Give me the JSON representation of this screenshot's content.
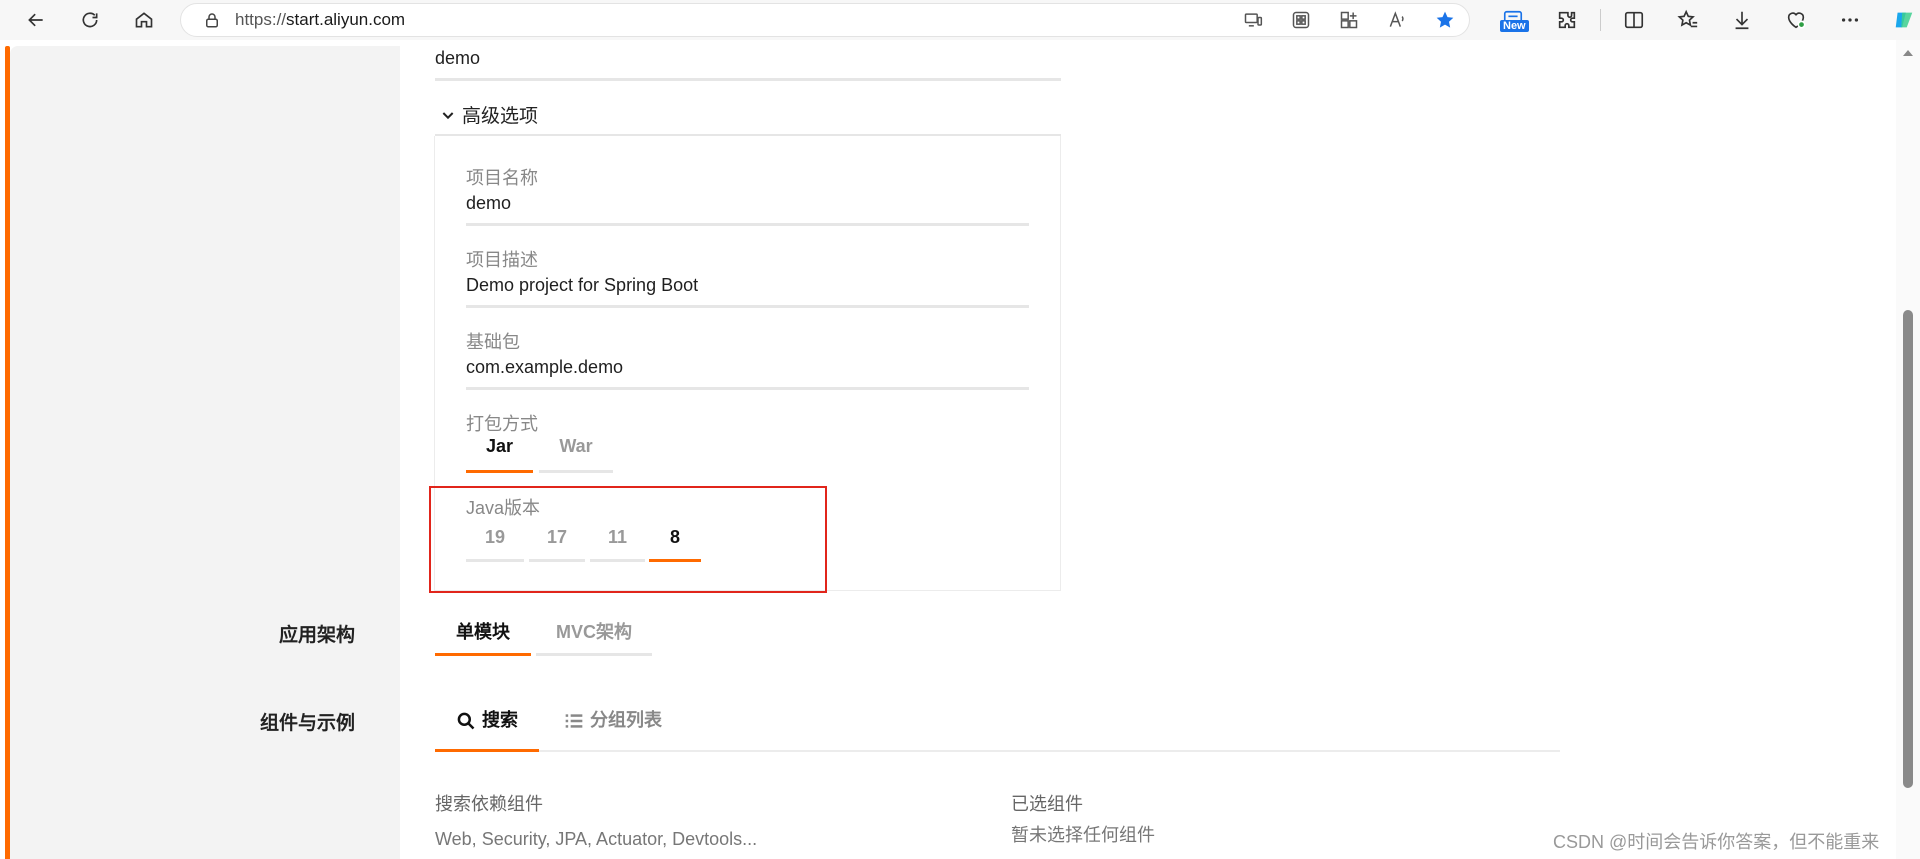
{
  "browser": {
    "url_scheme": "https://",
    "url_host": "start.aliyun.com",
    "new_badge": "New"
  },
  "form": {
    "artifact_value": "demo",
    "advanced_options_label": "高级选项",
    "project_name_label": "项目名称",
    "project_name_value": "demo",
    "description_label": "项目描述",
    "description_value": "Demo project for Spring Boot",
    "base_package_label": "基础包",
    "base_package_value": "com.example.demo",
    "packaging_label": "打包方式",
    "packaging_options": [
      "Jar",
      "War"
    ],
    "packaging_selected": "Jar",
    "java_version_label": "Java版本",
    "java_versions": [
      "19",
      "17",
      "11",
      "8"
    ],
    "java_version_selected": "8"
  },
  "architecture": {
    "label": "应用架构",
    "options": [
      "单模块",
      "MVC架构"
    ],
    "selected": "单模块"
  },
  "components": {
    "label": "组件与示例",
    "tabs": [
      "搜索",
      "分组列表"
    ],
    "selected_tab": "搜索",
    "search_label": "搜索依赖组件",
    "search_placeholder": "Web, Security, JPA, Actuator, Devtools...",
    "selected_label": "已选组件",
    "selected_empty": "暂未选择任何组件"
  },
  "watermark": "CSDN @时间会告诉你答案，但不能重来",
  "colors": {
    "accent": "#ff6a00",
    "highlight_border": "#e1251b",
    "edge_blue": "#1a73e8"
  }
}
